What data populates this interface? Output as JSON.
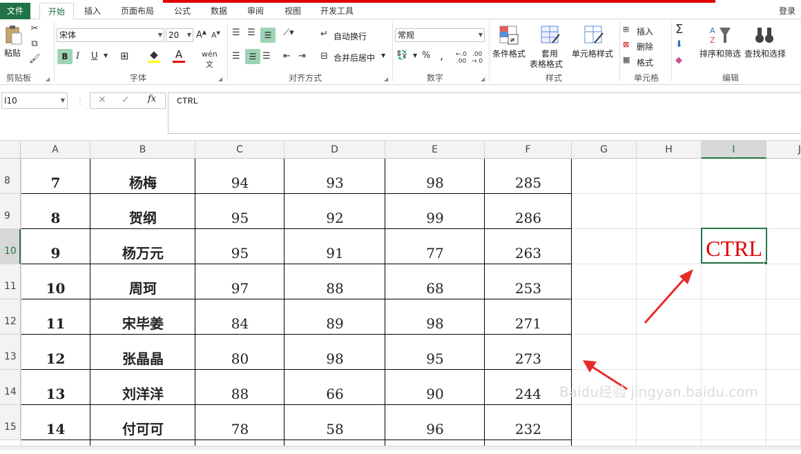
{
  "tabs": [
    "文件",
    "开始",
    "插入",
    "页面布局",
    "公式",
    "数据",
    "审阅",
    "视图",
    "开发工具"
  ],
  "login": "登录",
  "ribbon": {
    "clipboard": {
      "paste": "粘贴",
      "label": "剪贴板"
    },
    "font": {
      "name": "宋体",
      "size": "20",
      "label": "字体",
      "bold": "B",
      "italic": "I",
      "underline": "U"
    },
    "align": {
      "wrap": "自动换行",
      "merge": "合并后居中",
      "label": "对齐方式"
    },
    "number": {
      "format": "常规",
      "percent": "%",
      "comma": ",",
      "label": "数字"
    },
    "styles": {
      "cond": "条件格式",
      "table1": "套用",
      "table2": "表格格式",
      "cell": "单元格样式",
      "label": "样式"
    },
    "cells": {
      "insert": "插入",
      "delete": "删除",
      "format": "格式",
      "label": "单元格"
    },
    "edit": {
      "sort": "排序和筛选",
      "find": "查找和选择",
      "label": "编辑"
    }
  },
  "formula": {
    "namebox": "I10",
    "fx": "fx",
    "content": "CTRL"
  },
  "columns": [
    "A",
    "B",
    "C",
    "D",
    "E",
    "F",
    "G",
    "H",
    "I",
    "J"
  ],
  "rows": [
    {
      "num": "8",
      "a": "7",
      "b": "杨梅",
      "c": "94",
      "d": "93",
      "e": "98",
      "f": "285"
    },
    {
      "num": "9",
      "a": "8",
      "b": "贺纲",
      "c": "95",
      "d": "92",
      "e": "99",
      "f": "286"
    },
    {
      "num": "10",
      "a": "9",
      "b": "杨万元",
      "c": "95",
      "d": "91",
      "e": "77",
      "f": "263"
    },
    {
      "num": "11",
      "a": "10",
      "b": "周珂",
      "c": "97",
      "d": "88",
      "e": "68",
      "f": "253"
    },
    {
      "num": "12",
      "a": "11",
      "b": "宋毕姜",
      "c": "84",
      "d": "89",
      "e": "98",
      "f": "271"
    },
    {
      "num": "13",
      "a": "12",
      "b": "张晶晶",
      "c": "80",
      "d": "98",
      "e": "95",
      "f": "273"
    },
    {
      "num": "14",
      "a": "13",
      "b": "刘洋洋",
      "c": "88",
      "d": "66",
      "e": "90",
      "f": "244"
    },
    {
      "num": "15",
      "a": "14",
      "b": "付可可",
      "c": "78",
      "d": "58",
      "e": "96",
      "f": "232"
    }
  ],
  "active_cell": {
    "value": "CTRL",
    "color": "#e00000"
  },
  "watermark": "Baidu经验 jingyan.baidu.com",
  "colors": {
    "accent": "#217346",
    "red": "#e00000"
  }
}
